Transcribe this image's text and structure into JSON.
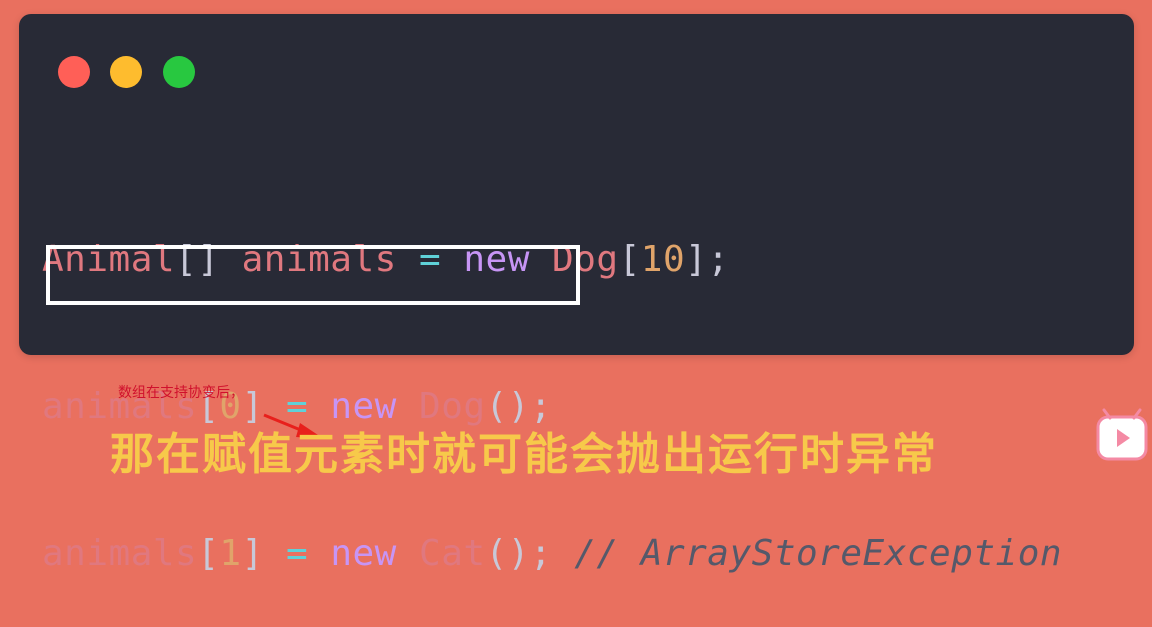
{
  "window_controls": {
    "close_color": "#ff5f57",
    "minimize_color": "#febc2e",
    "maximize_color": "#28c840"
  },
  "code": {
    "line1": [
      {
        "t": "Animal",
        "c": "type"
      },
      {
        "t": "[]",
        "c": "punct"
      },
      {
        "t": " animals ",
        "c": "ident"
      },
      {
        "t": "=",
        "c": "op"
      },
      {
        "t": " new ",
        "c": "kw"
      },
      {
        "t": "Dog",
        "c": "type"
      },
      {
        "t": "[",
        "c": "punct"
      },
      {
        "t": "10",
        "c": "num"
      },
      {
        "t": "];",
        "c": "punct"
      }
    ],
    "line2": [
      {
        "t": "animals",
        "c": "ident"
      },
      {
        "t": "[",
        "c": "punct"
      },
      {
        "t": "0",
        "c": "num"
      },
      {
        "t": "] ",
        "c": "punct"
      },
      {
        "t": "=",
        "c": "op"
      },
      {
        "t": " new ",
        "c": "kw"
      },
      {
        "t": "Dog",
        "c": "type"
      },
      {
        "t": "();",
        "c": "punct"
      }
    ],
    "line3": [
      {
        "t": "animals",
        "c": "ident"
      },
      {
        "t": "[",
        "c": "punct"
      },
      {
        "t": "1",
        "c": "num"
      },
      {
        "t": "] ",
        "c": "punct"
      },
      {
        "t": "=",
        "c": "op"
      },
      {
        "t": " new ",
        "c": "kw"
      },
      {
        "t": "Cat",
        "c": "type"
      },
      {
        "t": "();",
        "c": "punct"
      },
      {
        "t": " // ArrayStoreException",
        "c": "comment"
      }
    ]
  },
  "annotation": {
    "note": "数组在支持协变后，"
  },
  "subtitle": "那在赋值元素时就可能会抛出运行时异常",
  "icons": {
    "play": "play-video-icon"
  }
}
